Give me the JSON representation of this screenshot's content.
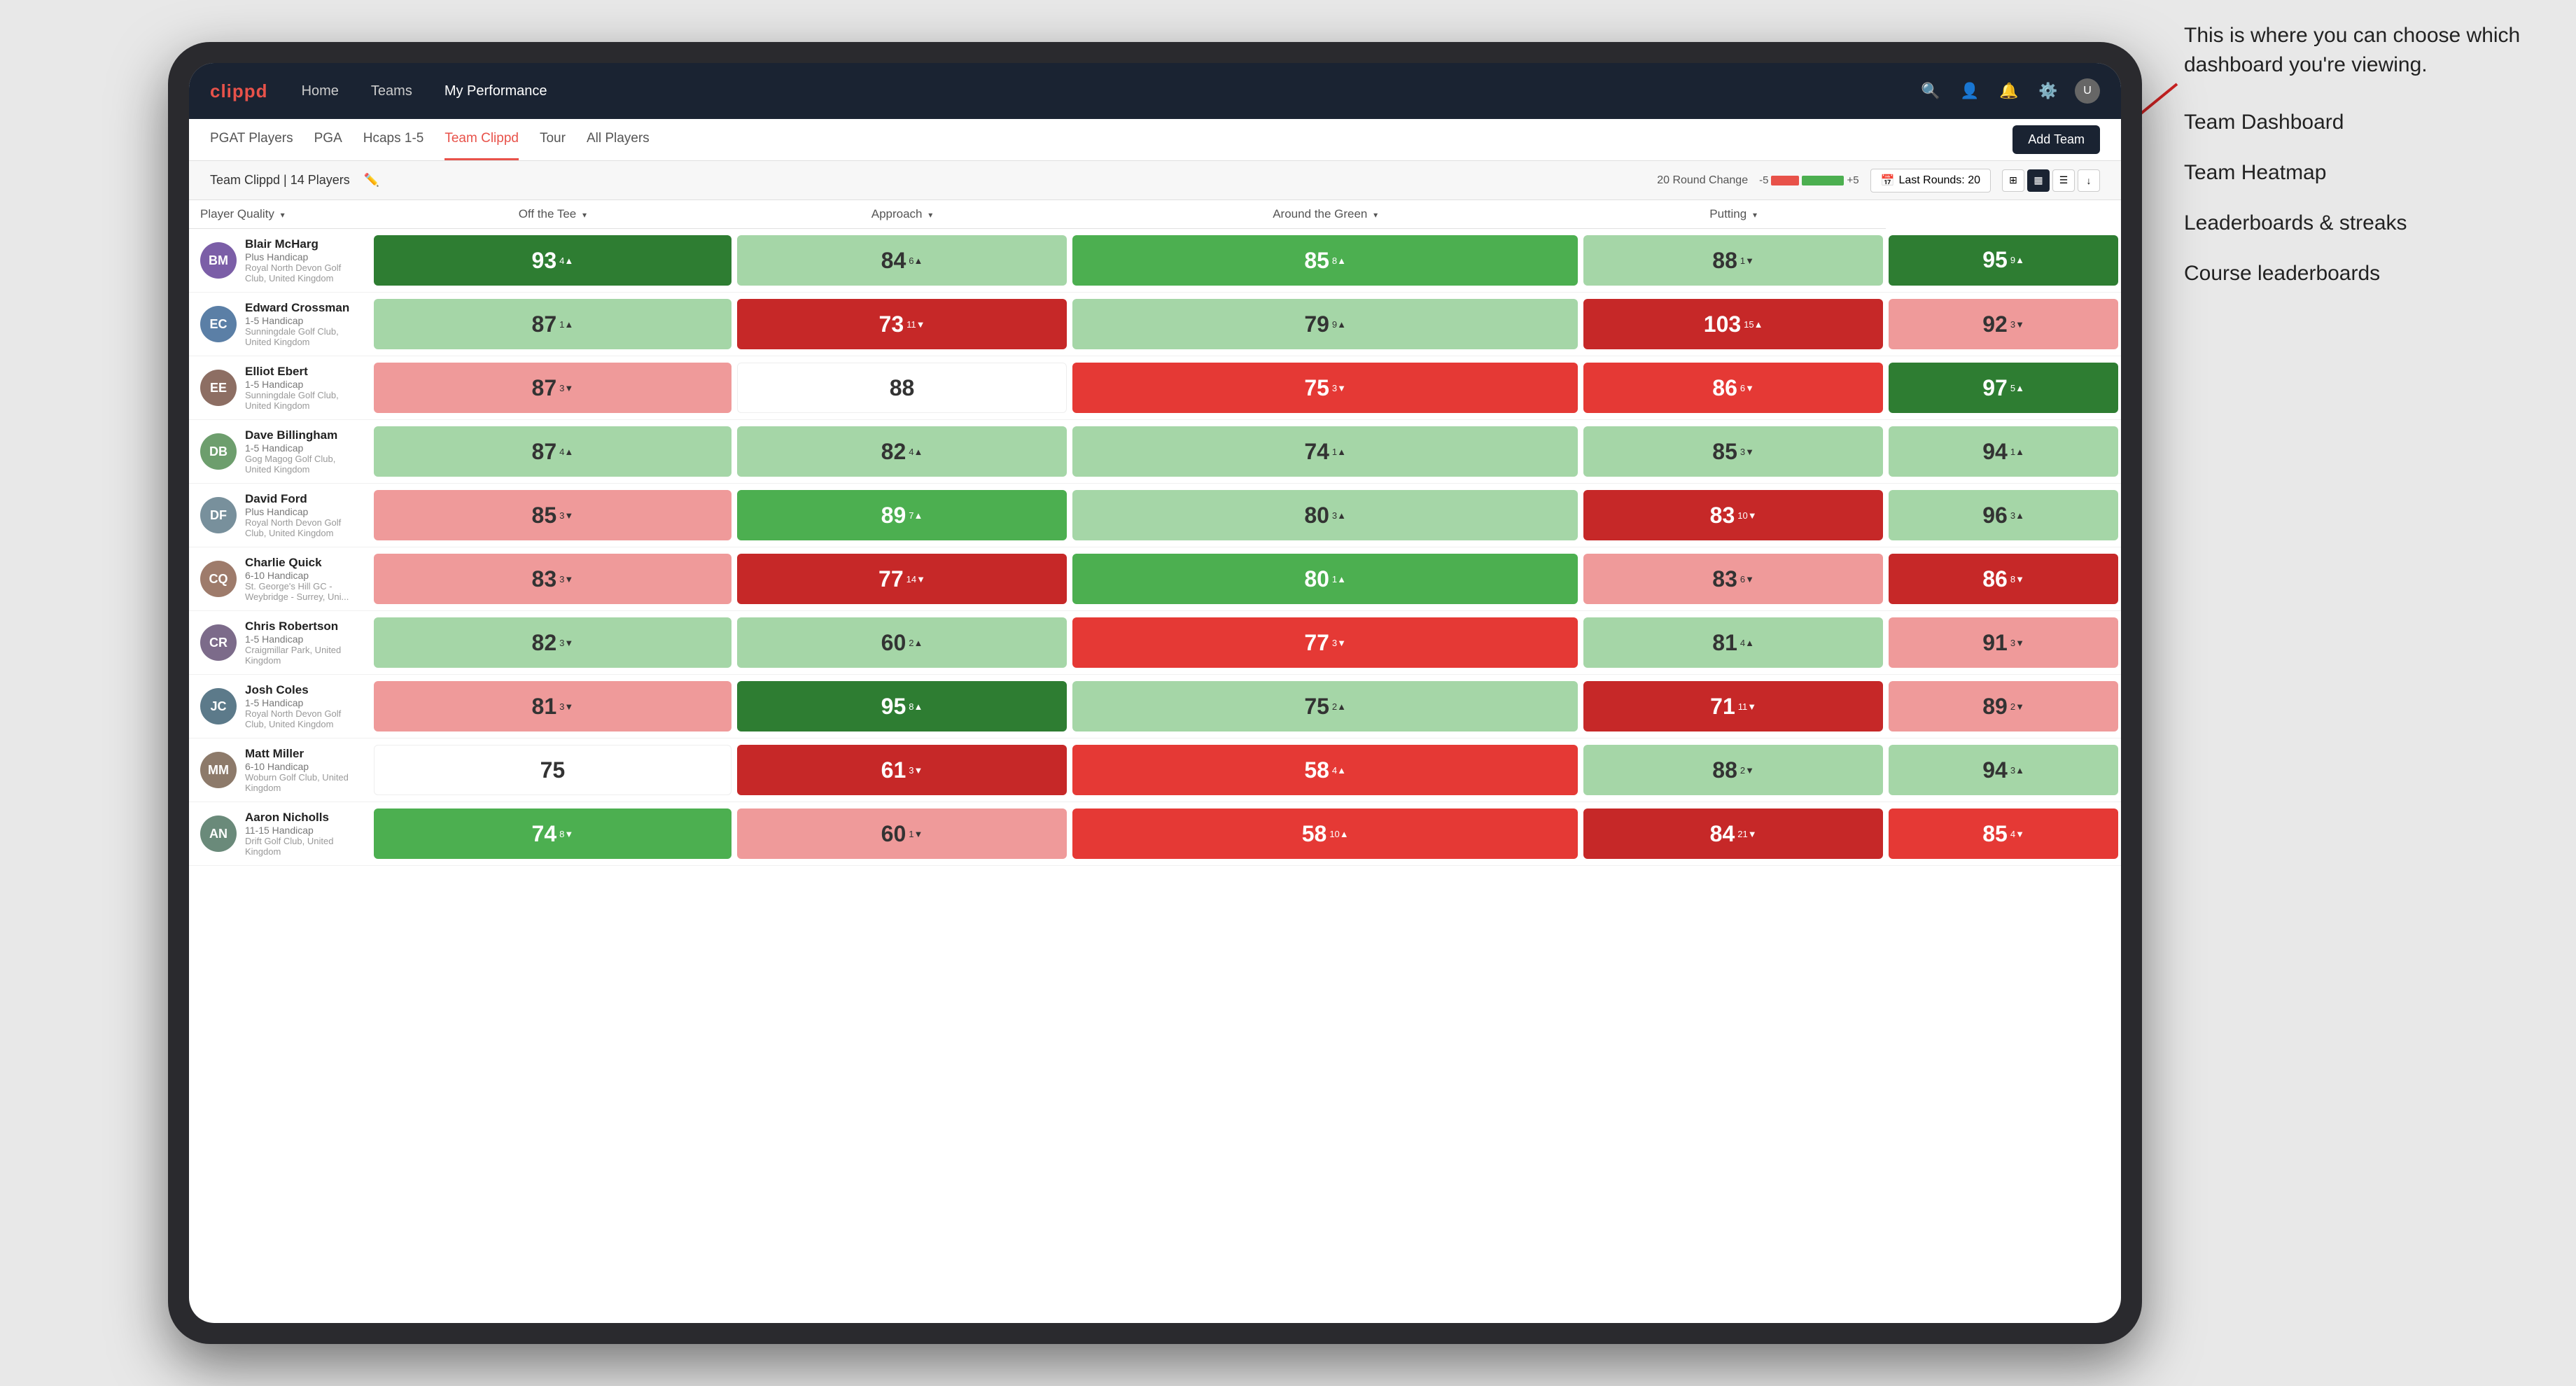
{
  "annotation": {
    "intro": "This is where you can choose which dashboard you're viewing.",
    "items": [
      "Team Dashboard",
      "Team Heatmap",
      "Leaderboards & streaks",
      "Course leaderboards"
    ]
  },
  "nav": {
    "logo": "clippd",
    "links": [
      "Home",
      "Teams",
      "My Performance"
    ],
    "active_link": "My Performance"
  },
  "secondary_tabs": [
    "PGAT Players",
    "PGA",
    "Hcaps 1-5",
    "Team Clippd",
    "Tour",
    "All Players"
  ],
  "active_secondary_tab": "Team Clippd",
  "add_team_label": "Add Team",
  "team_bar": {
    "team_name": "Team Clippd | 14 Players",
    "round_change_label": "20 Round Change",
    "range_neg": "-5",
    "range_pos": "+5",
    "last_rounds_label": "Last Rounds: 20"
  },
  "table": {
    "columns": [
      {
        "key": "player",
        "label": "Player Quality",
        "sort": "down"
      },
      {
        "key": "tee",
        "label": "Off the Tee",
        "sort": "down"
      },
      {
        "key": "approach",
        "label": "Approach",
        "sort": "down"
      },
      {
        "key": "around",
        "label": "Around the Green",
        "sort": "down"
      },
      {
        "key": "putting",
        "label": "Putting",
        "sort": "down"
      }
    ],
    "rows": [
      {
        "name": "Blair McHarg",
        "handicap": "Plus Handicap",
        "club": "Royal North Devon Golf Club, United Kingdom",
        "initials": "BM",
        "avatar_color": "#7b5ea7",
        "scores": [
          {
            "value": 93,
            "change": 4,
            "dir": "up",
            "bg": "green-dark"
          },
          {
            "value": 84,
            "change": 6,
            "dir": "up",
            "bg": "green-light"
          },
          {
            "value": 85,
            "change": 8,
            "dir": "up",
            "bg": "green-med"
          },
          {
            "value": 88,
            "change": 1,
            "dir": "down",
            "bg": "green-light"
          },
          {
            "value": 95,
            "change": 9,
            "dir": "up",
            "bg": "green-dark"
          }
        ]
      },
      {
        "name": "Edward Crossman",
        "handicap": "1-5 Handicap",
        "club": "Sunningdale Golf Club, United Kingdom",
        "initials": "EC",
        "avatar_color": "#5b7fa6",
        "scores": [
          {
            "value": 87,
            "change": 1,
            "dir": "up",
            "bg": "green-light"
          },
          {
            "value": 73,
            "change": 11,
            "dir": "down",
            "bg": "red-dark"
          },
          {
            "value": 79,
            "change": 9,
            "dir": "up",
            "bg": "green-light"
          },
          {
            "value": 103,
            "change": 15,
            "dir": "up",
            "bg": "red-dark"
          },
          {
            "value": 92,
            "change": 3,
            "dir": "down",
            "bg": "red-light"
          }
        ]
      },
      {
        "name": "Elliot Ebert",
        "handicap": "1-5 Handicap",
        "club": "Sunningdale Golf Club, United Kingdom",
        "initials": "EE",
        "avatar_color": "#8d6e63",
        "scores": [
          {
            "value": 87,
            "change": 3,
            "dir": "down",
            "bg": "red-light"
          },
          {
            "value": 88,
            "change": null,
            "dir": null,
            "bg": "white"
          },
          {
            "value": 75,
            "change": 3,
            "dir": "down",
            "bg": "red-med"
          },
          {
            "value": 86,
            "change": 6,
            "dir": "down",
            "bg": "red-med"
          },
          {
            "value": 97,
            "change": 5,
            "dir": "up",
            "bg": "green-dark"
          }
        ]
      },
      {
        "name": "Dave Billingham",
        "handicap": "1-5 Handicap",
        "club": "Gog Magog Golf Club, United Kingdom",
        "initials": "DB",
        "avatar_color": "#6d9e6d",
        "scores": [
          {
            "value": 87,
            "change": 4,
            "dir": "up",
            "bg": "green-light"
          },
          {
            "value": 82,
            "change": 4,
            "dir": "up",
            "bg": "green-light"
          },
          {
            "value": 74,
            "change": 1,
            "dir": "up",
            "bg": "green-light"
          },
          {
            "value": 85,
            "change": 3,
            "dir": "down",
            "bg": "green-light"
          },
          {
            "value": 94,
            "change": 1,
            "dir": "up",
            "bg": "green-light"
          }
        ]
      },
      {
        "name": "David Ford",
        "handicap": "Plus Handicap",
        "club": "Royal North Devon Golf Club, United Kingdom",
        "initials": "DF",
        "avatar_color": "#78909c",
        "scores": [
          {
            "value": 85,
            "change": 3,
            "dir": "down",
            "bg": "red-light"
          },
          {
            "value": 89,
            "change": 7,
            "dir": "up",
            "bg": "green-med"
          },
          {
            "value": 80,
            "change": 3,
            "dir": "up",
            "bg": "green-light"
          },
          {
            "value": 83,
            "change": 10,
            "dir": "down",
            "bg": "red-dark"
          },
          {
            "value": 96,
            "change": 3,
            "dir": "up",
            "bg": "green-light"
          }
        ]
      },
      {
        "name": "Charlie Quick",
        "handicap": "6-10 Handicap",
        "club": "St. George's Hill GC - Weybridge - Surrey, Uni...",
        "initials": "CQ",
        "avatar_color": "#9e7b6b",
        "scores": [
          {
            "value": 83,
            "change": 3,
            "dir": "down",
            "bg": "red-light"
          },
          {
            "value": 77,
            "change": 14,
            "dir": "down",
            "bg": "red-dark"
          },
          {
            "value": 80,
            "change": 1,
            "dir": "up",
            "bg": "green-med"
          },
          {
            "value": 83,
            "change": 6,
            "dir": "down",
            "bg": "red-light"
          },
          {
            "value": 86,
            "change": 8,
            "dir": "down",
            "bg": "red-dark"
          }
        ]
      },
      {
        "name": "Chris Robertson",
        "handicap": "1-5 Handicap",
        "club": "Craigmillar Park, United Kingdom",
        "initials": "CR",
        "avatar_color": "#7c6b8a",
        "scores": [
          {
            "value": 82,
            "change": 3,
            "dir": "down",
            "bg": "green-light"
          },
          {
            "value": 60,
            "change": 2,
            "dir": "up",
            "bg": "green-light"
          },
          {
            "value": 77,
            "change": 3,
            "dir": "down",
            "bg": "red-med"
          },
          {
            "value": 81,
            "change": 4,
            "dir": "up",
            "bg": "green-light"
          },
          {
            "value": 91,
            "change": 3,
            "dir": "down",
            "bg": "red-light"
          }
        ]
      },
      {
        "name": "Josh Coles",
        "handicap": "1-5 Handicap",
        "club": "Royal North Devon Golf Club, United Kingdom",
        "initials": "JC",
        "avatar_color": "#5c7a8a",
        "scores": [
          {
            "value": 81,
            "change": 3,
            "dir": "down",
            "bg": "red-light"
          },
          {
            "value": 95,
            "change": 8,
            "dir": "up",
            "bg": "green-dark"
          },
          {
            "value": 75,
            "change": 2,
            "dir": "up",
            "bg": "green-light"
          },
          {
            "value": 71,
            "change": 11,
            "dir": "down",
            "bg": "red-dark"
          },
          {
            "value": 89,
            "change": 2,
            "dir": "down",
            "bg": "red-light"
          }
        ]
      },
      {
        "name": "Matt Miller",
        "handicap": "6-10 Handicap",
        "club": "Woburn Golf Club, United Kingdom",
        "initials": "MM",
        "avatar_color": "#8d7a6a",
        "scores": [
          {
            "value": 75,
            "change": null,
            "dir": null,
            "bg": "white"
          },
          {
            "value": 61,
            "change": 3,
            "dir": "down",
            "bg": "red-dark"
          },
          {
            "value": 58,
            "change": 4,
            "dir": "up",
            "bg": "red-med"
          },
          {
            "value": 88,
            "change": 2,
            "dir": "down",
            "bg": "green-light"
          },
          {
            "value": 94,
            "change": 3,
            "dir": "up",
            "bg": "green-light"
          }
        ]
      },
      {
        "name": "Aaron Nicholls",
        "handicap": "11-15 Handicap",
        "club": "Drift Golf Club, United Kingdom",
        "initials": "AN",
        "avatar_color": "#6a8a7a",
        "scores": [
          {
            "value": 74,
            "change": 8,
            "dir": "down",
            "bg": "green-med"
          },
          {
            "value": 60,
            "change": 1,
            "dir": "down",
            "bg": "red-light"
          },
          {
            "value": 58,
            "change": 10,
            "dir": "up",
            "bg": "red-med"
          },
          {
            "value": 84,
            "change": 21,
            "dir": "down",
            "bg": "red-dark"
          },
          {
            "value": 85,
            "change": 4,
            "dir": "down",
            "bg": "red-med"
          }
        ]
      }
    ]
  },
  "colors": {
    "green_dark": "#2e7d32",
    "green_med": "#4caf50",
    "green_light": "#a5d6a7",
    "red_dark": "#c62828",
    "red_med": "#e53935",
    "red_light": "#ef9a9a",
    "white": "#ffffff",
    "nav_bg": "#1a2332",
    "accent": "#e8524a"
  }
}
